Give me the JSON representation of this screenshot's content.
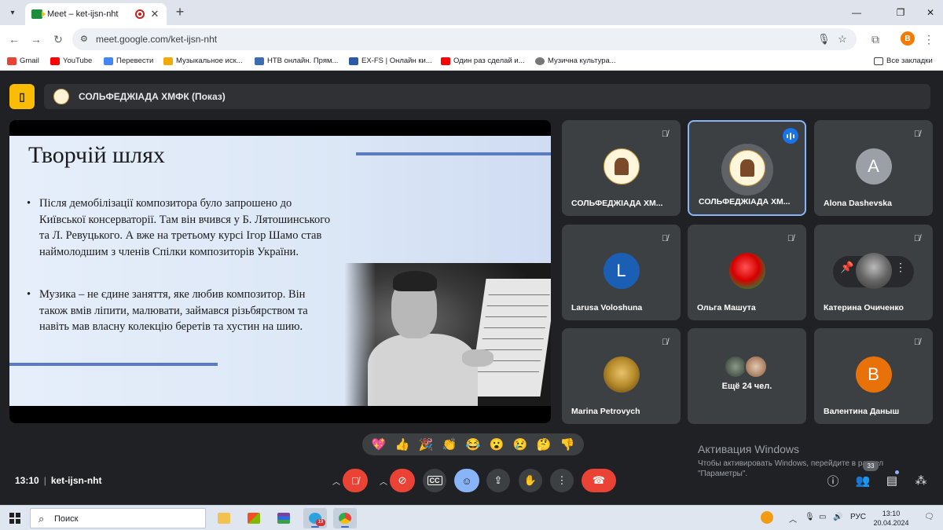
{
  "browser": {
    "tab_title": "Meet – ket-ijsn-nht",
    "url": "meet.google.com/ket-ijsn-nht",
    "profile_initial": "В",
    "bookmarks": [
      {
        "label": "Gmail",
        "icon": "gmail-icon"
      },
      {
        "label": "YouTube",
        "icon": "youtube-icon"
      },
      {
        "label": "Перевести",
        "icon": "translate-icon"
      },
      {
        "label": "Музыкальное иск...",
        "icon": "folder-icon"
      },
      {
        "label": "НТВ онлайн. Прям...",
        "icon": "monitor-icon"
      },
      {
        "label": "EX-FS | Онлайн ки...",
        "icon": "arrow-up-icon"
      },
      {
        "label": "Один раз сделай и...",
        "icon": "youtube-icon"
      },
      {
        "label": "Музична культура...",
        "icon": "globe-icon"
      }
    ],
    "all_bookmarks_label": "Все закладки"
  },
  "meet": {
    "presentation_title": "СОЛЬФЕДЖІАДА ХМФК (Показ)",
    "slide": {
      "title": "Творчій шлях",
      "bullets": [
        "Після демобілізації композитора було запрошено до Київської консерваторії. Там він вчився у Б. Лятошинського та Л. Ревуцького. А вже на третьому курсі Ігор Шамо став наймолодшим з членів Спілки композиторів України.",
        "Музика – не єдине заняття, яке любив композитор. Він також вмів ліпити, малювати, займався різьбярством та навіть мав власну колекцію беретів та хустин на шию."
      ]
    },
    "participants": [
      {
        "name": "СОЛЬФЕДЖІАДА ХМ...",
        "avatar": "logo",
        "muted": true,
        "speaking": false
      },
      {
        "name": "СОЛЬФЕДЖІАДА ХМ...",
        "avatar": "logo",
        "muted": false,
        "speaking": true
      },
      {
        "name": "Alona Dashevska",
        "avatar_letter": "A",
        "avatar_color": "#9aa0a6",
        "muted": true
      },
      {
        "name": "Larusa Voloshuna",
        "avatar_letter": "L",
        "avatar_color": "#1a5fb4",
        "muted": true
      },
      {
        "name": "Ольга Машута",
        "avatar": "photo-rose",
        "muted": true
      },
      {
        "name": "Катерина Очиченко",
        "avatar": "photo-statue",
        "muted": true
      },
      {
        "name": "Marina Petrovych",
        "avatar": "photo-painting",
        "muted": true
      },
      {
        "more_label": "Ещё 24 чел."
      },
      {
        "name": "Валентина Даныш",
        "avatar_letter": "В",
        "avatar_color": "#e8710a",
        "muted": true
      }
    ],
    "reactions": [
      "💖",
      "👍",
      "🎉",
      "👏",
      "😂",
      "😮",
      "😢",
      "🤔",
      "👎"
    ],
    "time": "13:10",
    "meeting_code": "ket-ijsn-nht",
    "people_count": "33"
  },
  "watermark": {
    "title": "Активация Windows",
    "subtitle": "Чтобы активировать Windows, перейдите в раздел \"Параметры\"."
  },
  "taskbar": {
    "search_placeholder": "Поиск",
    "telegram_badge": "19",
    "language": "РУС",
    "clock_time": "13:10",
    "clock_date": "20.04.2024"
  }
}
